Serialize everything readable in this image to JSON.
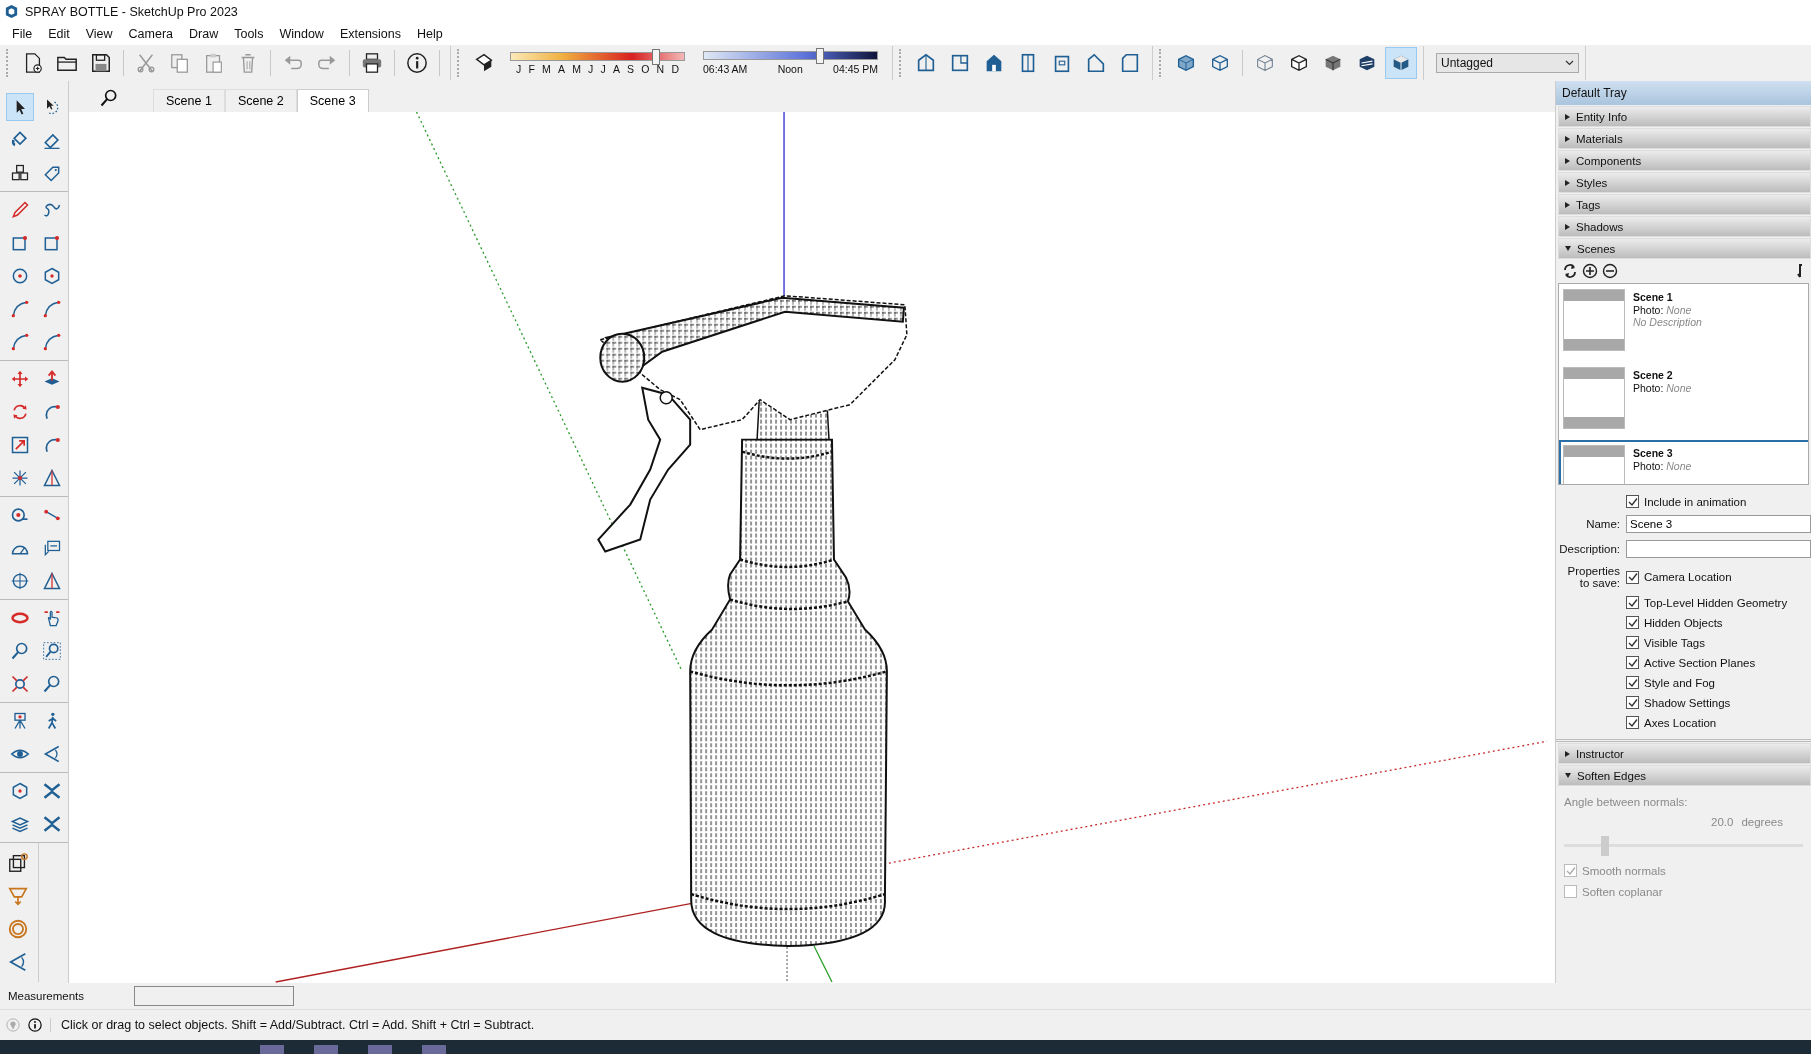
{
  "window": {
    "title": "SPRAY BOTTLE - SketchUp Pro 2023"
  },
  "menu": [
    "File",
    "Edit",
    "View",
    "Camera",
    "Draw",
    "Tools",
    "Window",
    "Extensions",
    "Help"
  ],
  "toolbar": {
    "groups": [
      {
        "buttons": [
          {
            "kind": "document"
          },
          {
            "kind": "folder"
          },
          {
            "kind": "floppy"
          }
        ]
      },
      {
        "buttons": [
          {
            "kind": "scissors"
          },
          {
            "kind": "copy"
          },
          {
            "kind": "clipboard"
          },
          {
            "kind": "trash"
          }
        ]
      },
      {
        "buttons": [
          {
            "kind": "undo"
          },
          {
            "kind": "redo"
          }
        ]
      },
      {
        "buttons": [
          {
            "kind": "printer"
          }
        ]
      },
      {
        "buttons": [
          {
            "kind": "info"
          }
        ]
      }
    ],
    "shadow_toggle": {
      "kind": "shadow"
    },
    "month_slider": {
      "labels": [
        "J",
        "F",
        "M",
        "A",
        "M",
        "J",
        "J",
        "A",
        "S",
        "O",
        "N",
        "D"
      ],
      "level": 0.84
    },
    "time_slider": {
      "labels": [
        "06:43 AM",
        "Noon",
        "04:45 PM"
      ],
      "level": 0.67
    },
    "views": [
      {
        "kind": "iso"
      },
      {
        "kind": "top"
      },
      {
        "kind": "front"
      },
      {
        "kind": "right"
      },
      {
        "kind": "back"
      },
      {
        "kind": "left"
      },
      {
        "kind": "bottom"
      }
    ],
    "xray": [
      {
        "kind": "xray"
      },
      {
        "kind": "backedges"
      }
    ],
    "face_styles": [
      {
        "kind": "wireframe",
        "selected": false
      },
      {
        "kind": "hidden",
        "selected": false
      },
      {
        "kind": "shaded",
        "selected": false
      },
      {
        "kind": "textured",
        "selected": false
      },
      {
        "kind": "monochrome",
        "selected": true
      }
    ],
    "tag_dropdown": {
      "value": "Untagged"
    }
  },
  "left_toolbar": {
    "groups": [
      {
        "tools": [
          {
            "kind": "cursor",
            "selected": true
          },
          {
            "kind": "lasso",
            "selected": false
          },
          {
            "kind": "bucket",
            "selected": false
          },
          {
            "kind": "eraser",
            "selected": false
          },
          {
            "kind": "cubes",
            "selected": false
          },
          {
            "kind": "tag",
            "selected": false
          }
        ]
      },
      {
        "tools": [
          {
            "kind": "pencil",
            "selected": false
          },
          {
            "kind": "squiggle",
            "selected": false
          },
          {
            "kind": "rectangle",
            "selected": false
          },
          {
            "kind": "rectangle",
            "selected": false
          },
          {
            "kind": "circle",
            "selected": false
          },
          {
            "kind": "hexagon",
            "selected": false
          },
          {
            "kind": "arc",
            "selected": false
          },
          {
            "kind": "arc",
            "selected": false
          },
          {
            "kind": "arc",
            "selected": false
          },
          {
            "kind": "arc",
            "selected": false
          }
        ]
      },
      {
        "tools": [
          {
            "kind": "move",
            "selected": false
          },
          {
            "kind": "pushpull",
            "selected": false
          },
          {
            "kind": "rotate",
            "selected": false
          },
          {
            "kind": "followme",
            "selected": false
          },
          {
            "kind": "scale",
            "selected": false
          },
          {
            "kind": "followme",
            "selected": false
          },
          {
            "kind": "star",
            "selected": false
          },
          {
            "kind": "triangle",
            "selected": false
          }
        ]
      },
      {
        "tools": [
          {
            "kind": "tape",
            "selected": false
          },
          {
            "kind": "dimension",
            "selected": false
          },
          {
            "kind": "protractor",
            "selected": false
          },
          {
            "kind": "label",
            "selected": false
          },
          {
            "kind": "axes",
            "selected": false
          },
          {
            "kind": "triangle",
            "selected": false
          }
        ]
      },
      {
        "tools": [
          {
            "kind": "section",
            "selected": false
          },
          {
            "kind": "hand",
            "selected": false
          },
          {
            "kind": "magnifier",
            "selected": false
          },
          {
            "kind": "zoomwindow",
            "selected": false
          },
          {
            "kind": "zoomextents",
            "selected": false
          },
          {
            "kind": "magnifier",
            "selected": false
          }
        ]
      },
      {
        "tools": [
          {
            "kind": "tripod",
            "selected": false
          },
          {
            "kind": "walker",
            "selected": false
          },
          {
            "kind": "eye",
            "selected": false
          },
          {
            "kind": "cone",
            "selected": false
          }
        ]
      },
      {
        "tools": [
          {
            "kind": "hexagon",
            "selected": false
          },
          {
            "kind": "extension",
            "selected": false
          },
          {
            "kind": "layers",
            "selected": false
          },
          {
            "kind": "extension",
            "selected": false
          }
        ]
      }
    ],
    "sandbox": [
      {
        "kind": "stack"
      },
      {
        "kind": "funnel"
      },
      {
        "kind": "rings"
      },
      {
        "kind": "cone"
      }
    ]
  },
  "scene_tabs": [
    {
      "label": "Scene 1",
      "selected": false
    },
    {
      "label": "Scene 2",
      "selected": false
    },
    {
      "label": "Scene 3",
      "selected": true
    }
  ],
  "tray": {
    "title": "Default Tray",
    "panels": [
      {
        "label": "Entity Info",
        "expanded": false
      },
      {
        "label": "Materials",
        "expanded": false
      },
      {
        "label": "Components",
        "expanded": false
      },
      {
        "label": "Styles",
        "expanded": false
      },
      {
        "label": "Tags",
        "expanded": false
      },
      {
        "label": "Shadows",
        "expanded": false
      },
      {
        "label": "Scenes",
        "expanded": true
      }
    ],
    "scenes": {
      "list": [
        {
          "name": "Scene 1",
          "photo_label": "Photo:",
          "photo": "None",
          "description": "No Description",
          "selected": false
        },
        {
          "name": "Scene 2",
          "photo_label": "Photo:",
          "photo": "None",
          "selected": false
        },
        {
          "name": "Scene 3",
          "photo_label": "Photo:",
          "photo": "None",
          "selected": true
        }
      ],
      "include_in_animation": {
        "label": "Include in animation",
        "checked": true
      },
      "name_label": "Name:",
      "name_value": "Scene 3",
      "description_label": "Description:",
      "properties_label": "Properties to save:",
      "properties": [
        {
          "label": "Camera Location",
          "checked": true
        },
        {
          "label": "Top-Level Hidden Geometry",
          "checked": true
        },
        {
          "label": "Hidden Objects",
          "checked": true
        },
        {
          "label": "Visible Tags",
          "checked": true
        },
        {
          "label": "Active Section Planes",
          "checked": true
        },
        {
          "label": "Style and Fog",
          "checked": true
        },
        {
          "label": "Shadow Settings",
          "checked": true
        },
        {
          "label": "Axes Location",
          "checked": true
        }
      ]
    },
    "lower_panels": [
      {
        "label": "Instructor",
        "expanded": false
      },
      {
        "label": "Soften Edges",
        "expanded": true
      }
    ],
    "soften": {
      "angle_label": "Angle between normals:",
      "angle": "20.0",
      "unit": "degrees",
      "level": 0.17,
      "options": [
        {
          "label": "Smooth normals",
          "checked": true,
          "disabled": true
        },
        {
          "label": "Soften coplanar",
          "checked": false,
          "disabled": true
        }
      ]
    }
  },
  "measurements": {
    "label": "Measurements"
  },
  "status_bar": {
    "text": "Click or drag to select objects. Shift = Add/Subtract. Ctrl = Add. Shift + Ctrl = Subtract."
  }
}
